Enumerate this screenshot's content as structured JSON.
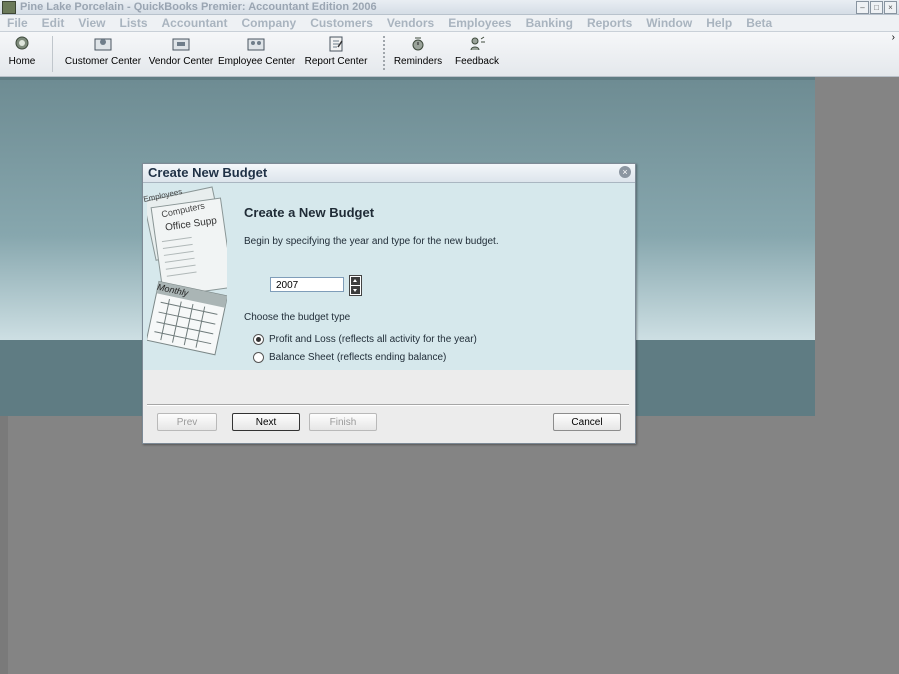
{
  "app": {
    "title": "Pine Lake Porcelain - QuickBooks Premier: Accountant Edition 2006",
    "window_buttons": [
      "–",
      "□",
      "×"
    ]
  },
  "menu": [
    "File",
    "Edit",
    "View",
    "Lists",
    "Accountant",
    "Company",
    "Customers",
    "Vendors",
    "Employees",
    "Banking",
    "Reports",
    "Window",
    "Help",
    "Beta"
  ],
  "toolbar": {
    "home": "Home",
    "customer_center": "Customer Center",
    "vendor_center": "Vendor Center",
    "employee_center": "Employee Center",
    "report_center": "Report Center",
    "reminders": "Reminders",
    "feedback": "Feedback",
    "more": "›"
  },
  "dialog": {
    "title": "Create New Budget",
    "close": "×",
    "heading": "Create a New Budget",
    "instruction": "Begin by specifying the year and type for the new budget.",
    "year_value": "2007",
    "type_label": "Choose the budget type",
    "options": [
      {
        "label": "Profit and Loss (reflects all activity for the year)",
        "selected": true
      },
      {
        "label": "Balance Sheet (reflects ending balance)",
        "selected": false
      }
    ],
    "buttons": {
      "prev": "Prev",
      "next": "Next",
      "finish": "Finish",
      "cancel": "Cancel"
    },
    "art_words": {
      "employees": "Employees",
      "computers": "Computers",
      "office_supplies": "Office Supp",
      "monthly": "Monthly"
    }
  }
}
